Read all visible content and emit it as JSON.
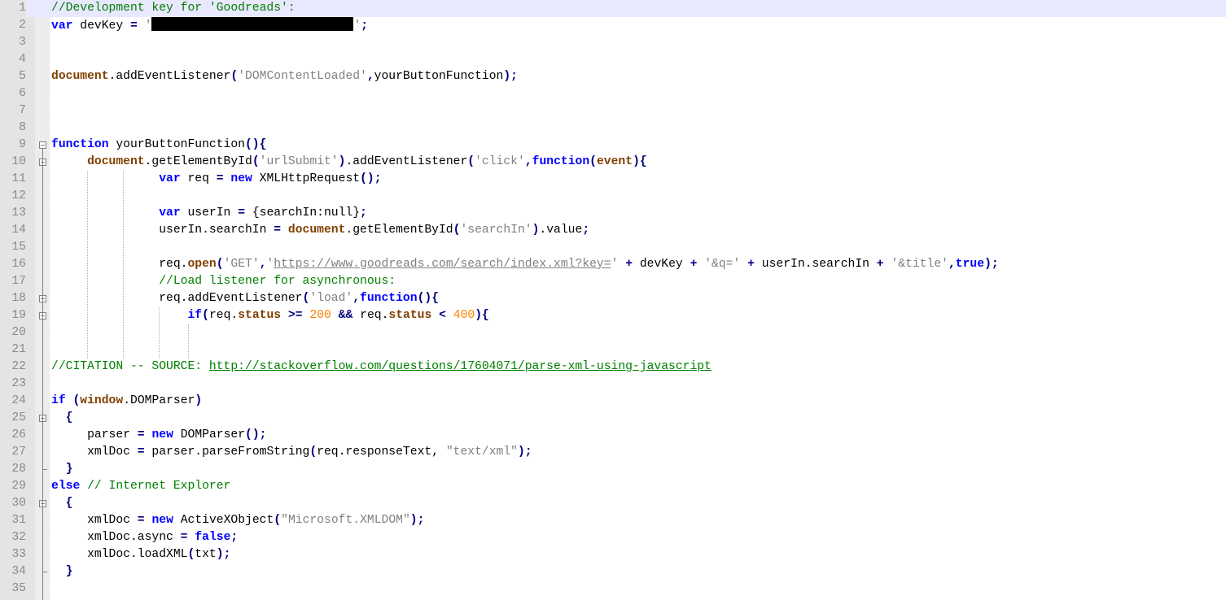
{
  "editor": {
    "language": "javascript",
    "current_line": 1,
    "line_numbers": [
      "1",
      "2",
      "3",
      "4",
      "5",
      "6",
      "7",
      "8",
      "9",
      "10",
      "11",
      "12",
      "13",
      "14",
      "15",
      "16",
      "17",
      "18",
      "19",
      "20",
      "21",
      "22",
      "23",
      "24",
      "25",
      "26",
      "27",
      "28",
      "29",
      "30",
      "31",
      "32",
      "33",
      "34",
      "35"
    ],
    "lines": [
      {
        "n": 1,
        "tokens": [
          {
            "t": "cm",
            "v": "//Development key for 'Goodreads':"
          }
        ]
      },
      {
        "n": 2,
        "tokens": [
          {
            "t": "kw",
            "v": "var"
          },
          {
            "t": "",
            "v": " devKey "
          },
          {
            "t": "op",
            "v": "="
          },
          {
            "t": "",
            "v": " "
          },
          {
            "t": "str",
            "v": "'"
          },
          {
            "t": "redact",
            "v": "[REDACTED]"
          },
          {
            "t": "str",
            "v": "'"
          },
          {
            "t": "op",
            "v": ";"
          }
        ]
      },
      {
        "n": 3,
        "tokens": []
      },
      {
        "n": 4,
        "tokens": []
      },
      {
        "n": 5,
        "tokens": [
          {
            "t": "obj",
            "v": "document"
          },
          {
            "t": "",
            "v": ".addEventListener"
          },
          {
            "t": "op",
            "v": "("
          },
          {
            "t": "str",
            "v": "'DOMContentLoaded'"
          },
          {
            "t": "op",
            "v": ","
          },
          {
            "t": "",
            "v": "yourButtonFunction"
          },
          {
            "t": "op",
            "v": ");"
          }
        ]
      },
      {
        "n": 6,
        "tokens": []
      },
      {
        "n": 7,
        "tokens": []
      },
      {
        "n": 8,
        "tokens": []
      },
      {
        "n": 9,
        "tokens": [
          {
            "t": "kw",
            "v": "function"
          },
          {
            "t": "",
            "v": " yourButtonFunction"
          },
          {
            "t": "op",
            "v": "(){"
          }
        ]
      },
      {
        "n": 10,
        "tokens": [
          {
            "t": "",
            "v": "     "
          },
          {
            "t": "obj",
            "v": "document"
          },
          {
            "t": "",
            "v": ".getElementById"
          },
          {
            "t": "op",
            "v": "("
          },
          {
            "t": "str",
            "v": "'urlSubmit'"
          },
          {
            "t": "op",
            "v": ")"
          },
          {
            "t": "",
            "v": ".addEventListener"
          },
          {
            "t": "op",
            "v": "("
          },
          {
            "t": "str",
            "v": "'click'"
          },
          {
            "t": "op",
            "v": ","
          },
          {
            "t": "kw",
            "v": "function"
          },
          {
            "t": "op",
            "v": "("
          },
          {
            "t": "obj",
            "v": "event"
          },
          {
            "t": "op",
            "v": "){"
          }
        ]
      },
      {
        "n": 11,
        "tokens": [
          {
            "t": "",
            "v": "               "
          },
          {
            "t": "kw",
            "v": "var"
          },
          {
            "t": "",
            "v": " req "
          },
          {
            "t": "op",
            "v": "="
          },
          {
            "t": "",
            "v": " "
          },
          {
            "t": "kw",
            "v": "new"
          },
          {
            "t": "",
            "v": " XMLHttpRequest"
          },
          {
            "t": "op",
            "v": "();"
          }
        ]
      },
      {
        "n": 12,
        "tokens": []
      },
      {
        "n": 13,
        "tokens": [
          {
            "t": "",
            "v": "               "
          },
          {
            "t": "kw",
            "v": "var"
          },
          {
            "t": "",
            "v": " userIn "
          },
          {
            "t": "op",
            "v": "="
          },
          {
            "t": "",
            "v": " {searchIn:null}"
          },
          {
            "t": "op",
            "v": ";"
          }
        ]
      },
      {
        "n": 14,
        "tokens": [
          {
            "t": "",
            "v": "               userIn.searchIn "
          },
          {
            "t": "op",
            "v": "="
          },
          {
            "t": "",
            "v": " "
          },
          {
            "t": "obj",
            "v": "document"
          },
          {
            "t": "",
            "v": ".getElementById"
          },
          {
            "t": "op",
            "v": "("
          },
          {
            "t": "str",
            "v": "'searchIn'"
          },
          {
            "t": "op",
            "v": ")"
          },
          {
            "t": "",
            "v": ".value"
          },
          {
            "t": "op",
            "v": ";"
          }
        ]
      },
      {
        "n": 15,
        "tokens": []
      },
      {
        "n": 16,
        "tokens": [
          {
            "t": "",
            "v": "               req."
          },
          {
            "t": "obj",
            "v": "open"
          },
          {
            "t": "op",
            "v": "("
          },
          {
            "t": "str",
            "v": "'GET'"
          },
          {
            "t": "op",
            "v": ","
          },
          {
            "t": "str",
            "v": "'"
          },
          {
            "t": "strlink",
            "v": "https://www.goodreads.com/search/index.xml?key="
          },
          {
            "t": "str",
            "v": "'"
          },
          {
            "t": "",
            "v": " "
          },
          {
            "t": "op",
            "v": "+"
          },
          {
            "t": "",
            "v": " devKey "
          },
          {
            "t": "op",
            "v": "+"
          },
          {
            "t": "",
            "v": " "
          },
          {
            "t": "str",
            "v": "'&q='"
          },
          {
            "t": "",
            "v": " "
          },
          {
            "t": "op",
            "v": "+"
          },
          {
            "t": "",
            "v": " userIn.searchIn "
          },
          {
            "t": "op",
            "v": "+"
          },
          {
            "t": "",
            "v": " "
          },
          {
            "t": "str",
            "v": "'&title'"
          },
          {
            "t": "op",
            "v": ","
          },
          {
            "t": "kw",
            "v": "true"
          },
          {
            "t": "op",
            "v": ");"
          }
        ]
      },
      {
        "n": 17,
        "tokens": [
          {
            "t": "",
            "v": "               "
          },
          {
            "t": "cm",
            "v": "//Load listener for asynchronous:"
          }
        ]
      },
      {
        "n": 18,
        "tokens": [
          {
            "t": "",
            "v": "               req.addEventListener"
          },
          {
            "t": "op",
            "v": "("
          },
          {
            "t": "str",
            "v": "'load'"
          },
          {
            "t": "op",
            "v": ","
          },
          {
            "t": "kw",
            "v": "function"
          },
          {
            "t": "op",
            "v": "(){"
          }
        ]
      },
      {
        "n": 19,
        "tokens": [
          {
            "t": "",
            "v": "                   "
          },
          {
            "t": "kw",
            "v": "if"
          },
          {
            "t": "op",
            "v": "("
          },
          {
            "t": "",
            "v": "req."
          },
          {
            "t": "obj",
            "v": "status"
          },
          {
            "t": "",
            "v": " "
          },
          {
            "t": "op",
            "v": ">="
          },
          {
            "t": "",
            "v": " "
          },
          {
            "t": "num",
            "v": "200"
          },
          {
            "t": "",
            "v": " "
          },
          {
            "t": "op",
            "v": "&&"
          },
          {
            "t": "",
            "v": " req."
          },
          {
            "t": "obj",
            "v": "status"
          },
          {
            "t": "",
            "v": " "
          },
          {
            "t": "op",
            "v": "<"
          },
          {
            "t": "",
            "v": " "
          },
          {
            "t": "num",
            "v": "400"
          },
          {
            "t": "op",
            "v": "){"
          }
        ]
      },
      {
        "n": 20,
        "tokens": []
      },
      {
        "n": 21,
        "tokens": []
      },
      {
        "n": 22,
        "tokens": [
          {
            "t": "cm",
            "v": "//CITATION -- SOURCE: "
          },
          {
            "t": "cmlink",
            "v": "http://stackoverflow.com/questions/17604071/parse-xml-using-javascript"
          }
        ]
      },
      {
        "n": 23,
        "tokens": []
      },
      {
        "n": 24,
        "tokens": [
          {
            "t": "kw",
            "v": "if"
          },
          {
            "t": "",
            "v": " "
          },
          {
            "t": "op",
            "v": "("
          },
          {
            "t": "obj",
            "v": "window"
          },
          {
            "t": "",
            "v": ".DOMParser"
          },
          {
            "t": "op",
            "v": ")"
          }
        ]
      },
      {
        "n": 25,
        "tokens": [
          {
            "t": "",
            "v": "  "
          },
          {
            "t": "op",
            "v": "{"
          }
        ]
      },
      {
        "n": 26,
        "tokens": [
          {
            "t": "",
            "v": "     parser "
          },
          {
            "t": "op",
            "v": "="
          },
          {
            "t": "",
            "v": " "
          },
          {
            "t": "kw",
            "v": "new"
          },
          {
            "t": "",
            "v": " DOMParser"
          },
          {
            "t": "op",
            "v": "();"
          }
        ]
      },
      {
        "n": 27,
        "tokens": [
          {
            "t": "",
            "v": "     xmlDoc "
          },
          {
            "t": "op",
            "v": "="
          },
          {
            "t": "",
            "v": " parser.parseFromString"
          },
          {
            "t": "op",
            "v": "("
          },
          {
            "t": "",
            "v": "req.responseText, "
          },
          {
            "t": "str",
            "v": "\"text/xml\""
          },
          {
            "t": "op",
            "v": ");"
          }
        ]
      },
      {
        "n": 28,
        "tokens": [
          {
            "t": "",
            "v": "  "
          },
          {
            "t": "op",
            "v": "}"
          }
        ]
      },
      {
        "n": 29,
        "tokens": [
          {
            "t": "kw",
            "v": "else"
          },
          {
            "t": "",
            "v": " "
          },
          {
            "t": "cm",
            "v": "// Internet Explorer"
          }
        ]
      },
      {
        "n": 30,
        "tokens": [
          {
            "t": "",
            "v": "  "
          },
          {
            "t": "op",
            "v": "{"
          }
        ]
      },
      {
        "n": 31,
        "tokens": [
          {
            "t": "",
            "v": "     xmlDoc "
          },
          {
            "t": "op",
            "v": "="
          },
          {
            "t": "",
            "v": " "
          },
          {
            "t": "kw",
            "v": "new"
          },
          {
            "t": "",
            "v": " ActiveXObject"
          },
          {
            "t": "op",
            "v": "("
          },
          {
            "t": "str",
            "v": "\"Microsoft.XMLDOM\""
          },
          {
            "t": "op",
            "v": ");"
          }
        ]
      },
      {
        "n": 32,
        "tokens": [
          {
            "t": "",
            "v": "     xmlDoc.async "
          },
          {
            "t": "op",
            "v": "="
          },
          {
            "t": "",
            "v": " "
          },
          {
            "t": "kw",
            "v": "false"
          },
          {
            "t": "op",
            "v": ";"
          }
        ]
      },
      {
        "n": 33,
        "tokens": [
          {
            "t": "",
            "v": "     xmlDoc.loadXML"
          },
          {
            "t": "op",
            "v": "("
          },
          {
            "t": "",
            "v": "txt"
          },
          {
            "t": "op",
            "v": ");"
          }
        ]
      },
      {
        "n": 34,
        "tokens": [
          {
            "t": "",
            "v": "  "
          },
          {
            "t": "op",
            "v": "}"
          }
        ]
      },
      {
        "n": 35,
        "tokens": []
      }
    ],
    "fold_markers": [
      9,
      10,
      18,
      19,
      25,
      30
    ],
    "fold_ends": [
      28,
      34
    ]
  },
  "colors": {
    "keyword": "#0000ff",
    "object": "#804000",
    "string": "#808080",
    "number": "#ff8000",
    "operator": "#000080",
    "comment": "#008000",
    "current_line_bg": "#e8e8ff",
    "gutter_bg": "#e4e4e4"
  }
}
